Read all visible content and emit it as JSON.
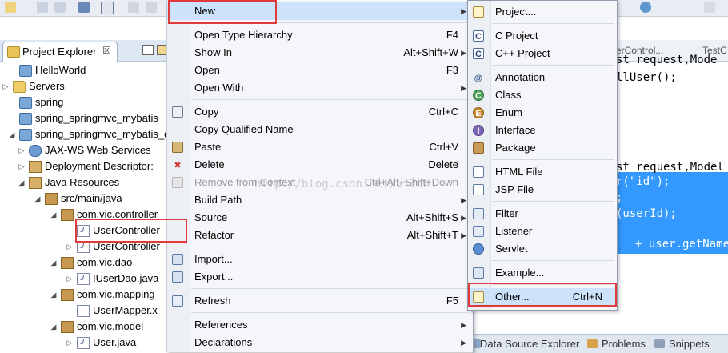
{
  "explorer": {
    "tab_title": "Project Explorer",
    "tab_close": "☒",
    "tree": [
      {
        "label": "HelloWorld",
        "icon": "project-icon",
        "arrow": ""
      },
      {
        "label": "Servers",
        "icon": "folder-icon",
        "arrow": "▷"
      },
      {
        "label": "spring",
        "icon": "project-icon",
        "arrow": ""
      },
      {
        "label": "spring_springmvc_mybatis",
        "icon": "project-icon",
        "arrow": ""
      },
      {
        "label": "spring_springmvc_mybatis_d",
        "icon": "web-project-icon",
        "arrow": "◢"
      },
      {
        "label": "JAX-WS Web Services",
        "icon": "webservice-icon",
        "arrow": "▷"
      },
      {
        "label": "Deployment Descriptor:",
        "icon": "descriptor-icon",
        "arrow": "▷"
      },
      {
        "label": "Java Resources",
        "icon": "java-resources-icon",
        "arrow": "◢"
      },
      {
        "label": "src/main/java",
        "icon": "source-folder-icon",
        "arrow": "◢"
      },
      {
        "label": "com.vic.controller",
        "icon": "package-icon",
        "arrow": "◢"
      },
      {
        "label": "UserController",
        "icon": "java-file-icon",
        "arrow": ""
      },
      {
        "label": "UserController",
        "icon": "java-file-icon",
        "arrow": "▷"
      },
      {
        "label": "com.vic.dao",
        "icon": "package-icon",
        "arrow": "◢"
      },
      {
        "label": "IUserDao.java",
        "icon": "java-file-icon",
        "arrow": "▷"
      },
      {
        "label": "com.vic.mapping",
        "icon": "package-icon",
        "arrow": "◢"
      },
      {
        "label": "UserMapper.x",
        "icon": "xml-file-icon",
        "arrow": ""
      },
      {
        "label": "com.vic.model",
        "icon": "package-icon",
        "arrow": "◢"
      },
      {
        "label": "User.java",
        "icon": "java-file-icon",
        "arrow": "▷"
      }
    ]
  },
  "editor": {
    "tabs": [
      "erControl...",
      "TestC"
    ],
    "lines": [
      {
        "text": "st request,Mode",
        "selected": false
      },
      {
        "text": "llUser();",
        "selected": false
      },
      {
        "text": "st request,Model",
        "selected": false
      },
      {
        "text": "r(\"id\");",
        "selected": true
      },
      {
        "text": ";",
        "selected": true
      },
      {
        "text": "(userId);",
        "selected": true
      },
      {
        "text": "+ user.getName()",
        "selected": true
      }
    ]
  },
  "bottom_views": [
    "Data Source Explorer",
    "Problems",
    "Snippets"
  ],
  "context_menu": {
    "items": [
      {
        "label": "New",
        "shortcut": "",
        "submenu": true,
        "icon": "",
        "highlighted": true
      },
      {
        "sep": true
      },
      {
        "label": "Open Type Hierarchy",
        "shortcut": "F4",
        "submenu": false,
        "icon": ""
      },
      {
        "label": "Show In",
        "shortcut": "Alt+Shift+W",
        "submenu": true,
        "icon": ""
      },
      {
        "label": "Open",
        "shortcut": "F3",
        "submenu": false,
        "icon": ""
      },
      {
        "label": "Open With",
        "shortcut": "",
        "submenu": true,
        "icon": ""
      },
      {
        "sep": true
      },
      {
        "label": "Copy",
        "shortcut": "Ctrl+C",
        "submenu": false,
        "icon": "copy-icon"
      },
      {
        "label": "Copy Qualified Name",
        "shortcut": "",
        "submenu": false,
        "icon": ""
      },
      {
        "label": "Paste",
        "shortcut": "Ctrl+V",
        "submenu": false,
        "icon": "paste-icon"
      },
      {
        "label": "Delete",
        "shortcut": "Delete",
        "submenu": false,
        "icon": "delete-icon"
      },
      {
        "label": "Remove from Context",
        "shortcut": "Ctrl+Alt+Shift+Down",
        "submenu": false,
        "icon": "remove-context-icon",
        "disabled": true
      },
      {
        "label": "Build Path",
        "shortcut": "",
        "submenu": true,
        "icon": ""
      },
      {
        "label": "Source",
        "shortcut": "Alt+Shift+S",
        "submenu": true,
        "icon": ""
      },
      {
        "label": "Refactor",
        "shortcut": "Alt+Shift+T",
        "submenu": true,
        "icon": ""
      },
      {
        "sep": true
      },
      {
        "label": "Import...",
        "shortcut": "",
        "submenu": false,
        "icon": "import-icon"
      },
      {
        "label": "Export...",
        "shortcut": "",
        "submenu": false,
        "icon": "export-icon"
      },
      {
        "sep": true
      },
      {
        "label": "Refresh",
        "shortcut": "F5",
        "submenu": false,
        "icon": "refresh-icon"
      },
      {
        "sep": true
      },
      {
        "label": "References",
        "shortcut": "",
        "submenu": true,
        "icon": ""
      },
      {
        "label": "Declarations",
        "shortcut": "",
        "submenu": true,
        "icon": ""
      }
    ]
  },
  "new_submenu": {
    "items": [
      {
        "label": "Project...",
        "shortcut": "",
        "icon": "project-wizard-icon"
      },
      {
        "sep": true
      },
      {
        "label": "C Project",
        "shortcut": "",
        "icon": "c-project-icon"
      },
      {
        "label": "C++ Project",
        "shortcut": "",
        "icon": "cpp-project-icon"
      },
      {
        "sep": true
      },
      {
        "label": "Annotation",
        "shortcut": "",
        "icon": "annotation-icon"
      },
      {
        "label": "Class",
        "shortcut": "",
        "icon": "class-icon"
      },
      {
        "label": "Enum",
        "shortcut": "",
        "icon": "enum-icon"
      },
      {
        "label": "Interface",
        "shortcut": "",
        "icon": "interface-icon"
      },
      {
        "label": "Package",
        "shortcut": "",
        "icon": "package-icon"
      },
      {
        "sep": true
      },
      {
        "label": "HTML File",
        "shortcut": "",
        "icon": "html-file-icon"
      },
      {
        "label": "JSP File",
        "shortcut": "",
        "icon": "jsp-file-icon"
      },
      {
        "sep": true
      },
      {
        "label": "Filter",
        "shortcut": "",
        "icon": "filter-icon"
      },
      {
        "label": "Listener",
        "shortcut": "",
        "icon": "listener-icon"
      },
      {
        "label": "Servlet",
        "shortcut": "",
        "icon": "servlet-icon"
      },
      {
        "sep": true
      },
      {
        "label": "Example...",
        "shortcut": "",
        "icon": "example-icon"
      },
      {
        "sep": true
      },
      {
        "label": "Other...",
        "shortcut": "Ctrl+N",
        "icon": "other-wizard-icon",
        "highlighted": true
      }
    ]
  },
  "watermark": "http://blog.csdn.net/vicon",
  "colors": {
    "selection": "#3399ff",
    "annotation_red": "#e03a3a",
    "menu_bg": "#f4f6f9"
  }
}
